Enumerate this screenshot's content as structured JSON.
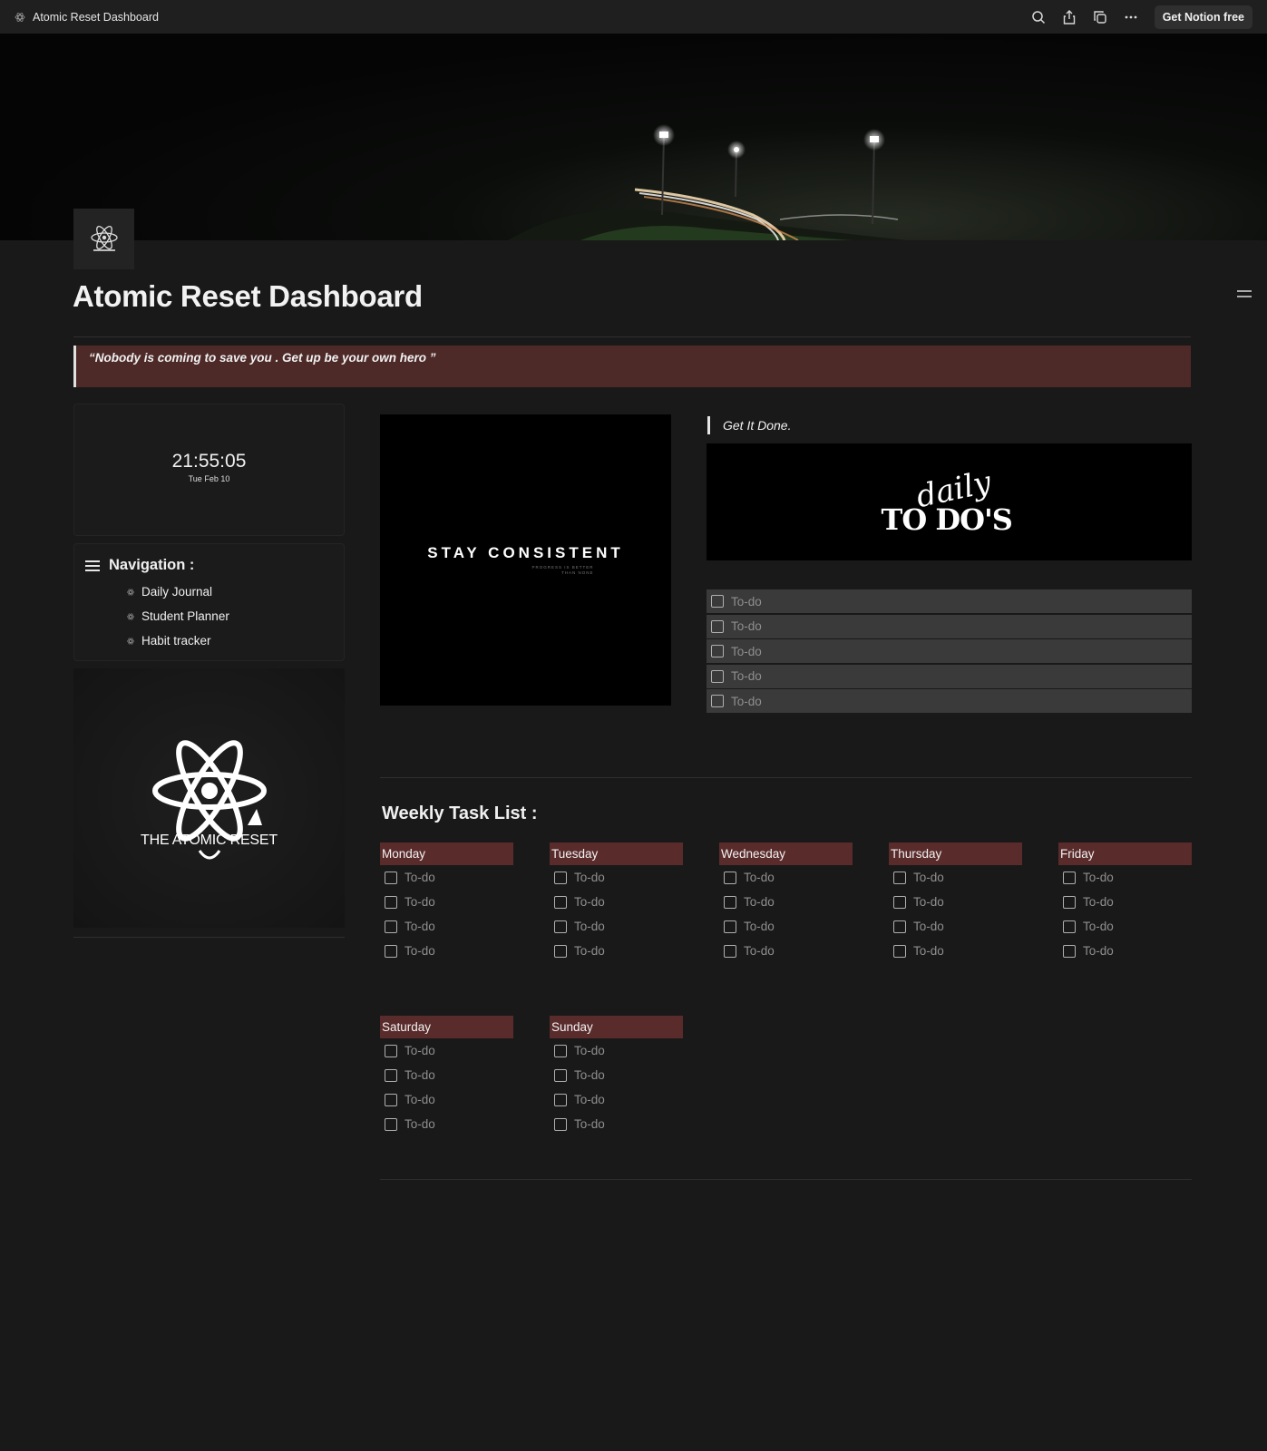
{
  "topbar": {
    "breadcrumb": "Atomic Reset Dashboard",
    "cta_label": "Get Notion free",
    "icons": [
      "search-icon",
      "share-icon",
      "duplicate-icon",
      "more-icon"
    ]
  },
  "page": {
    "title": "Atomic Reset Dashboard",
    "quote": "“Nobody is coming to save you .  Get up be your own hero ”"
  },
  "clock": {
    "time": "21:55:05",
    "date": "Tue Feb 10"
  },
  "navigation": {
    "title": "Navigation :",
    "items": [
      {
        "label": "Daily Journal"
      },
      {
        "label": "Student Planner"
      },
      {
        "label": "Habit tracker"
      }
    ]
  },
  "atom_card": {
    "title": "THE ATOMIC RESET"
  },
  "stay_card": {
    "title": "STAY CONSISTENT",
    "subtitle_line1": "PROGRESS IS BETTER",
    "subtitle_line2": "THAN NONE"
  },
  "get_it_done": {
    "callout": "Get It Done.",
    "banner_script": "daily",
    "banner_title": "TO DO'S",
    "todos": [
      "To-do",
      "To-do",
      "To-do",
      "To-do",
      "To-do"
    ]
  },
  "weekly": {
    "title": "Weekly Task List :",
    "days": [
      {
        "name": "Monday",
        "todos": [
          "To-do",
          "To-do",
          "To-do",
          "To-do"
        ]
      },
      {
        "name": "Tuesday",
        "todos": [
          "To-do",
          "To-do",
          "To-do",
          "To-do"
        ]
      },
      {
        "name": "Wednesday",
        "todos": [
          "To-do",
          "To-do",
          "To-do",
          "To-do"
        ]
      },
      {
        "name": "Thursday",
        "todos": [
          "To-do",
          "To-do",
          "To-do",
          "To-do"
        ]
      },
      {
        "name": "Friday",
        "todos": [
          "To-do",
          "To-do",
          "To-do",
          "To-do"
        ]
      },
      {
        "name": "Saturday",
        "todos": [
          "To-do",
          "To-do",
          "To-do",
          "To-do"
        ]
      },
      {
        "name": "Sunday",
        "todos": [
          "To-do",
          "To-do",
          "To-do",
          "To-do"
        ]
      }
    ]
  },
  "colors": {
    "background": "#191919",
    "quote_bg": "#4d2a28",
    "day_header_bg": "#5a2b2b",
    "todo_row_bg": "#3a3a3a"
  }
}
